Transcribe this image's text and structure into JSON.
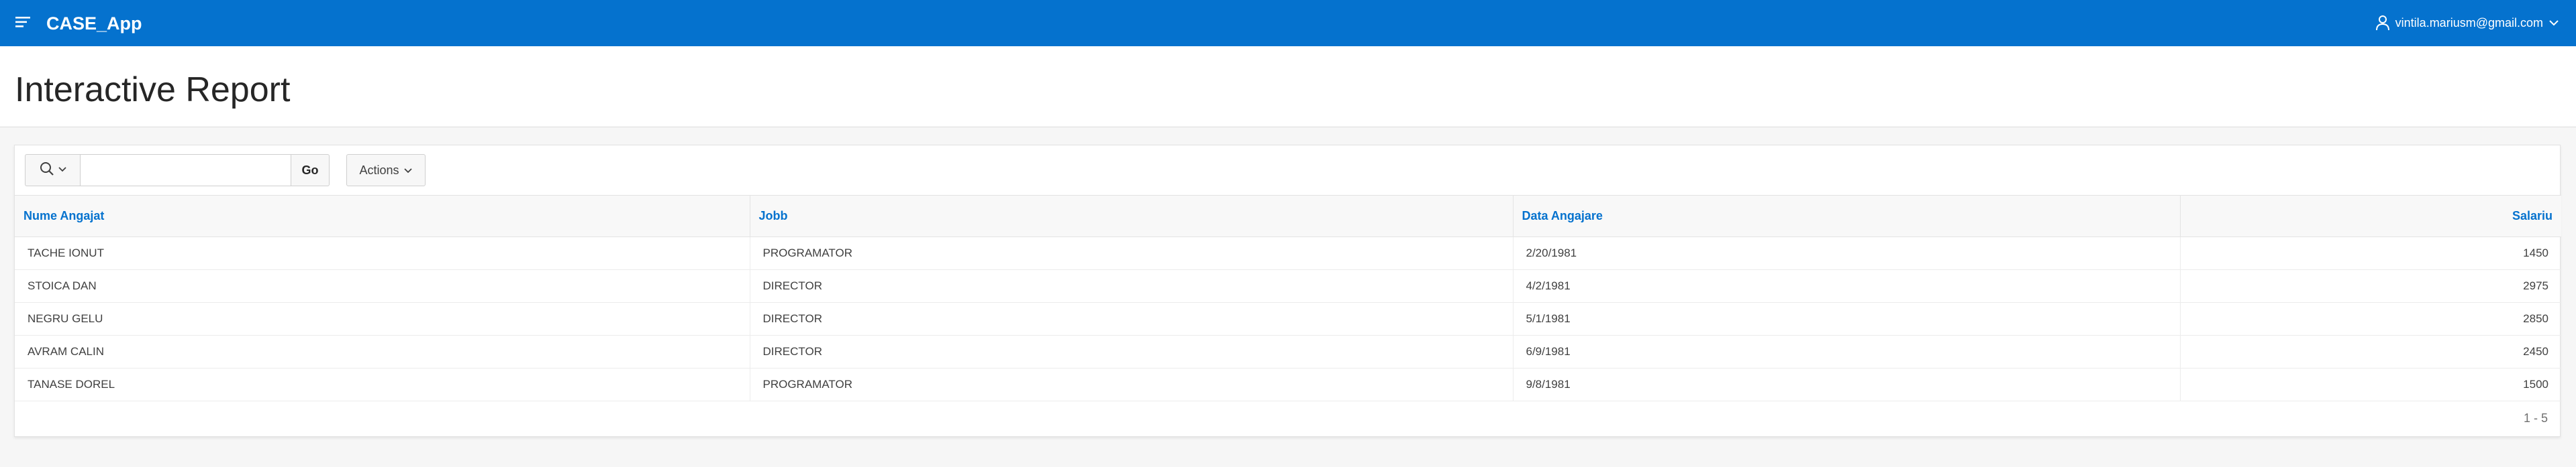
{
  "header": {
    "app_title": "CASE_App",
    "user_email": "vintila.mariusm@gmail.com",
    "background_color": "#0572ce"
  },
  "page": {
    "title": "Interactive Report"
  },
  "toolbar": {
    "search_placeholder": "",
    "search_value": "",
    "go_label": "Go",
    "actions_label": "Actions"
  },
  "table": {
    "columns": [
      "Nume Angajat",
      "Jobb",
      "Data Angajare",
      "Salariu"
    ],
    "rows": [
      [
        "TACHE IONUT",
        "PROGRAMATOR",
        "2/20/1981",
        "1450"
      ],
      [
        "STOICA DAN",
        "DIRECTOR",
        "4/2/1981",
        "2975"
      ],
      [
        "NEGRU GELU",
        "DIRECTOR",
        "5/1/1981",
        "2850"
      ],
      [
        "AVRAM CALIN",
        "DIRECTOR",
        "6/9/1981",
        "2450"
      ],
      [
        "TANASE DOREL",
        "PROGRAMATOR",
        "9/8/1981",
        "1500"
      ]
    ]
  },
  "pagination": {
    "range": "1 - 5"
  },
  "icons": {
    "menu": "hamburger-menu-icon",
    "user": "user-icon",
    "user_chevron": "chevron-down-icon",
    "search": "search-icon",
    "search_chevron": "chevron-down-icon",
    "actions_chevron": "chevron-down-icon"
  }
}
